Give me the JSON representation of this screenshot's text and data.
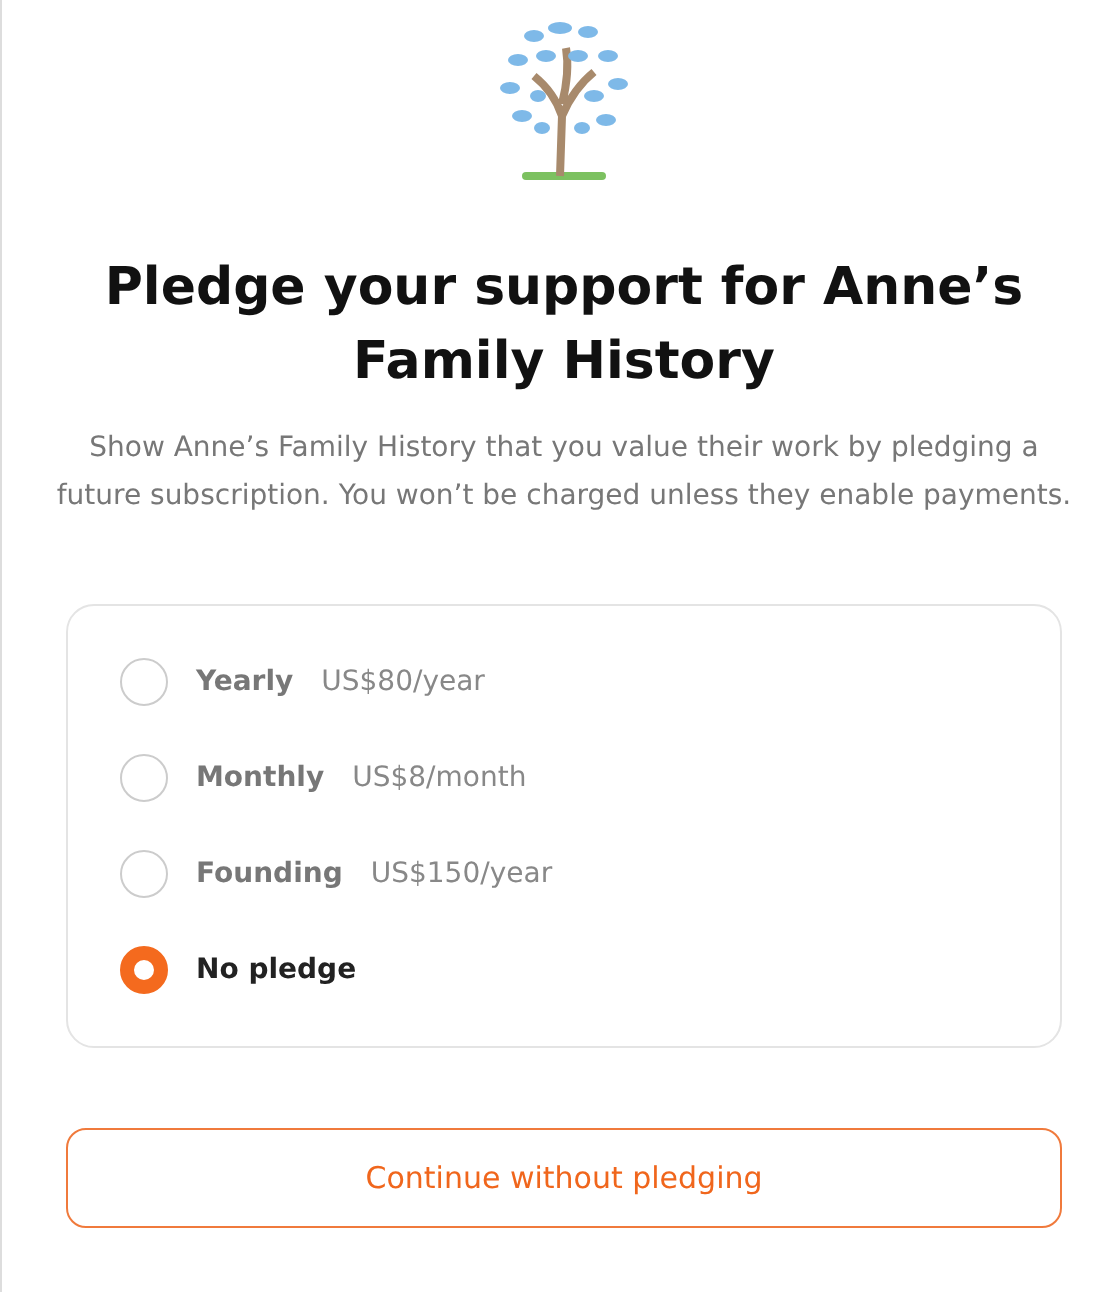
{
  "title": "Pledge your support for Anne’s Family History",
  "description": "Show Anne’s Family History that you value their work by pledging a future subscription. You won’t be charged unless they enable payments.",
  "options": [
    {
      "label": "Yearly",
      "price": "US$80/year",
      "selected": false
    },
    {
      "label": "Monthly",
      "price": "US$8/month",
      "selected": false
    },
    {
      "label": "Founding",
      "price": "US$150/year",
      "selected": false
    },
    {
      "label": "No pledge",
      "selected": true
    }
  ],
  "button": "Continue without pledging"
}
